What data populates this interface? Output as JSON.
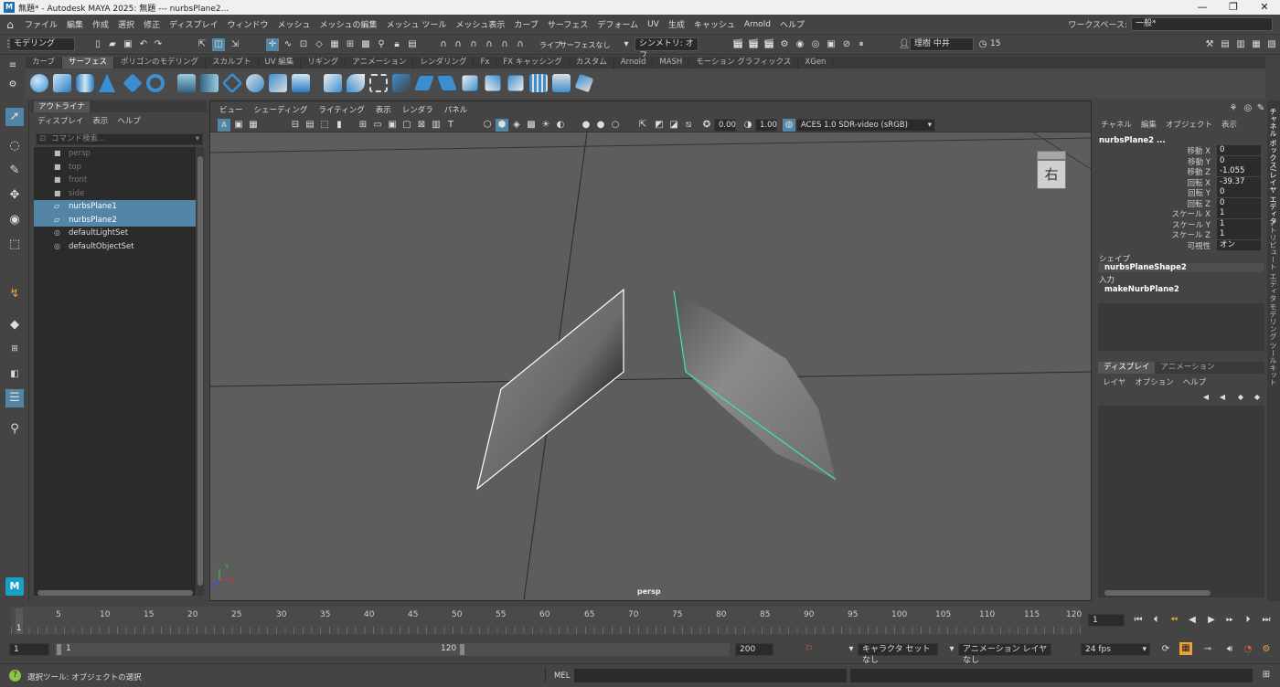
{
  "window": {
    "title": "無題* - Autodesk MAYA 2025: 無題   ---   nurbsPlane2...",
    "logo": "M"
  },
  "menubar": {
    "items": [
      "ファイル",
      "編集",
      "作成",
      "選択",
      "修正",
      "ディスプレイ",
      "ウィンドウ",
      "メッシュ",
      "メッシュの編集",
      "メッシュ ツール",
      "メッシュ表示",
      "カーブ",
      "サーフェス",
      "デフォーム",
      "UV",
      "生成",
      "キャッシュ",
      "Arnold",
      "ヘルプ"
    ],
    "workspace_label": "ワークスペース:",
    "workspace_value": "一般*"
  },
  "statusline": {
    "mode": "モデリング",
    "live_label": "ライブ",
    "live_value": "サーフェスなし",
    "symmetry": "シンメトリ: オフ",
    "user": "理樹 中井",
    "notifications": "15"
  },
  "shelf": {
    "tabs": [
      "カーブ",
      "サーフェス",
      "ポリゴンのモデリング",
      "スカルプト",
      "UV 編集",
      "リギング",
      "アニメーション",
      "レンダリング",
      "Fx",
      "FX キャッシング",
      "カスタム",
      "Arnold",
      "MASH",
      "モーション グラフィックス",
      "XGen"
    ],
    "active_tab": "サーフェス"
  },
  "outliner": {
    "tab": "アウトライナ",
    "menus": [
      "ディスプレイ",
      "表示",
      "ヘルプ"
    ],
    "search_placeholder": "コマンド検索...",
    "items": [
      {
        "label": "persp",
        "state": "dim",
        "icon": "camera-icon"
      },
      {
        "label": "top",
        "state": "dim",
        "icon": "camera-icon"
      },
      {
        "label": "front",
        "state": "dim",
        "icon": "camera-icon"
      },
      {
        "label": "side",
        "state": "dim",
        "icon": "camera-icon"
      },
      {
        "label": "nurbsPlane1",
        "state": "sel",
        "icon": "nurbs-plane-icon"
      },
      {
        "label": "nurbsPlane2",
        "state": "sel",
        "icon": "nurbs-plane-icon"
      },
      {
        "label": "defaultLightSet",
        "state": "normal",
        "icon": "set-icon"
      },
      {
        "label": "defaultObjectSet",
        "state": "normal",
        "icon": "set-icon"
      }
    ]
  },
  "viewport": {
    "menus": [
      "ビュー",
      "シェーディング",
      "ライティング",
      "表示",
      "レンダラ",
      "パネル"
    ],
    "exposure": "0.00",
    "gamma": "1.00",
    "colorspace": "ACES 1.0 SDR-video (sRGB)",
    "camera_label": "persp",
    "viewcube_label": "右",
    "axis_y": "Y",
    "axis_x": "X",
    "axis_z": "Z"
  },
  "channelbox": {
    "menus": [
      "チャネル",
      "編集",
      "オブジェクト",
      "表示"
    ],
    "object": "nurbsPlane2 ...",
    "attributes": [
      {
        "name": "移動 X",
        "value": "0"
      },
      {
        "name": "移動 Y",
        "value": "0"
      },
      {
        "name": "移動 Z",
        "value": "-1.055"
      },
      {
        "name": "回転 X",
        "value": "-39.37"
      },
      {
        "name": "回転 Y",
        "value": "0"
      },
      {
        "name": "回転 Z",
        "value": "0"
      },
      {
        "name": "スケール X",
        "value": "1"
      },
      {
        "name": "スケール Y",
        "value": "1"
      },
      {
        "name": "スケール Z",
        "value": "1"
      },
      {
        "name": "可視性",
        "value": "オン"
      }
    ],
    "shape_header": "シェイプ",
    "shape_name": "nurbsPlaneShape2",
    "input_header": "入力",
    "input_name": "makeNurbPlane2",
    "layer_tabs": [
      "ディスプレイ",
      "アニメーション"
    ],
    "layer_menus": [
      "レイヤ",
      "オプション",
      "ヘルプ"
    ]
  },
  "sidetabs": [
    "チャネル ボックス/レイヤ エディタ",
    "アトリビュート エディタ",
    "モデリング ツールキット"
  ],
  "timeslider": {
    "ticks": [
      "5",
      "10",
      "15",
      "20",
      "25",
      "30",
      "35",
      "40",
      "45",
      "50",
      "55",
      "60",
      "65",
      "70",
      "75",
      "80",
      "85",
      "90",
      "95",
      "100",
      "105",
      "110",
      "115",
      "120"
    ],
    "current_frame_marker": "1",
    "current_frame": "1"
  },
  "rangeslider": {
    "start": "1",
    "inner_start": "1",
    "inner_end": "120",
    "end": "200",
    "character_set": "キャラクタ セットなし",
    "anim_layer": "アニメーション レイヤなし",
    "fps": "24 fps"
  },
  "cmdline": {
    "help_text": "選択ツール: オブジェクトの選択",
    "lang": "MEL"
  }
}
